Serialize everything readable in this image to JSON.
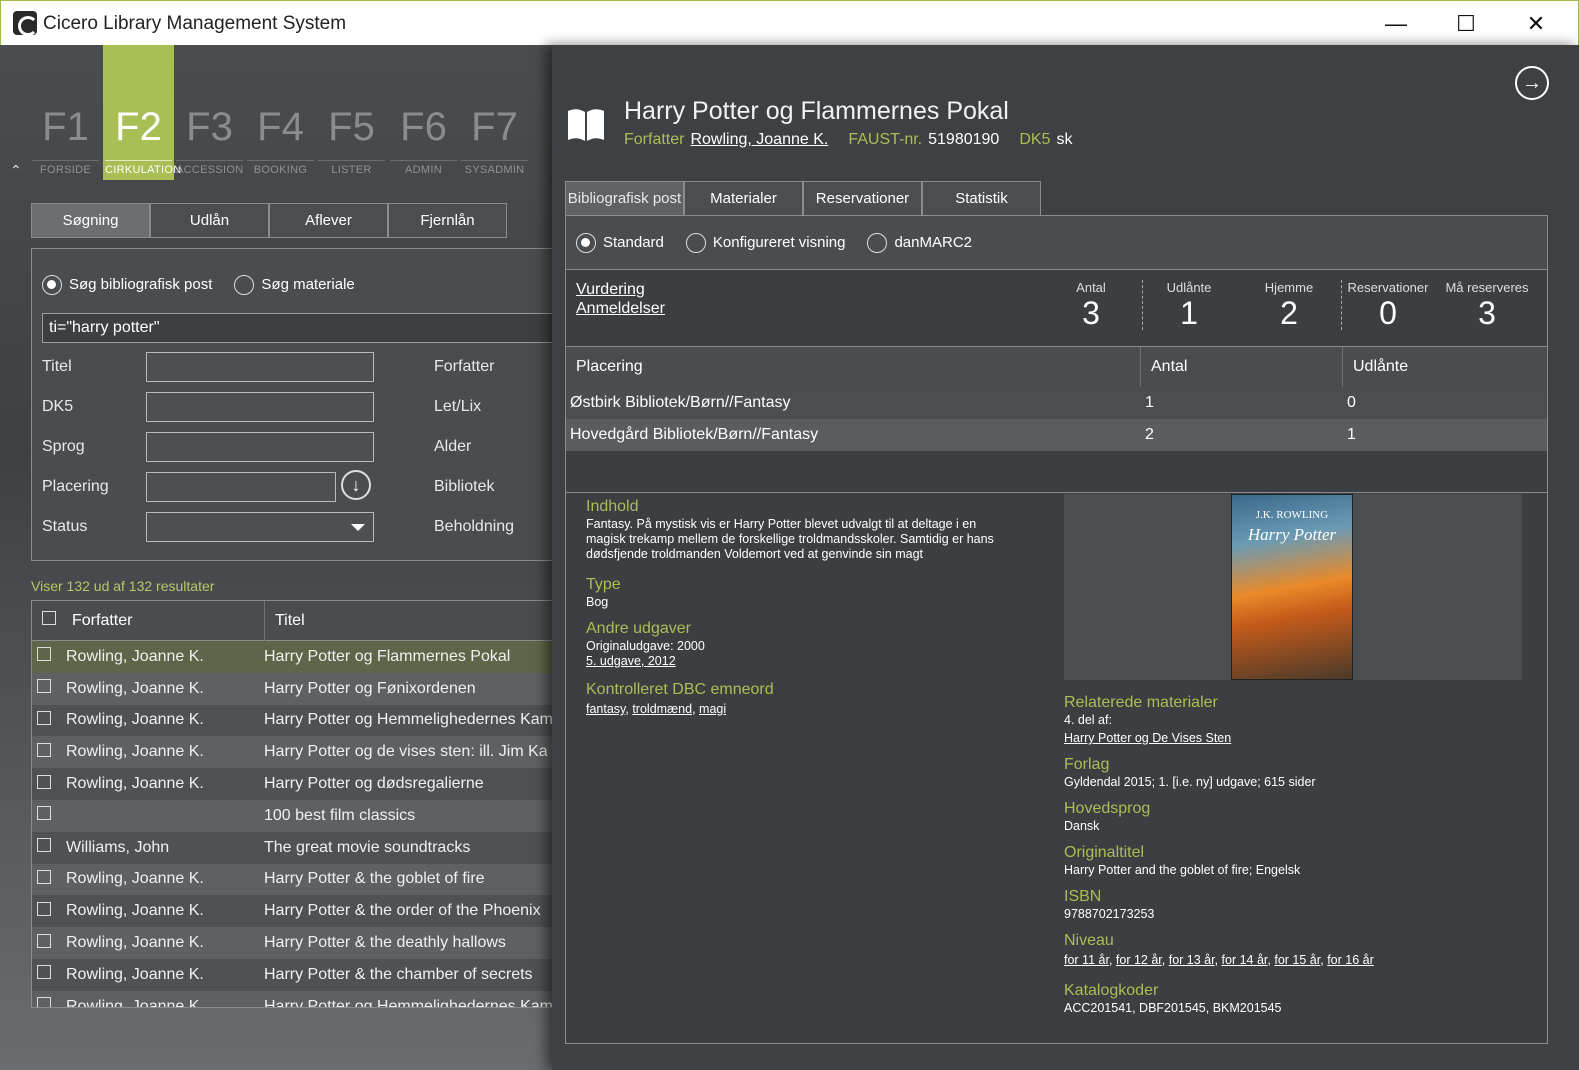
{
  "window": {
    "title": "Cicero Library Management System"
  },
  "fkeys": [
    {
      "key": "F1",
      "label": "FORSIDE"
    },
    {
      "key": "F2",
      "label": "CIRKULATION",
      "active": true
    },
    {
      "key": "F3",
      "label": "ACCESSION"
    },
    {
      "key": "F4",
      "label": "BOOKING"
    },
    {
      "key": "F5",
      "label": "LISTER"
    },
    {
      "key": "F6",
      "label": "ADMIN"
    },
    {
      "key": "F7",
      "label": "SYSADMIN"
    }
  ],
  "left_tabs": [
    "Søgning",
    "Udlån",
    "Aflever",
    "Fjernlån"
  ],
  "search": {
    "radio_bib": "Søg bibliografisk post",
    "radio_mat": "Søg materiale",
    "query": "ti=\"harry potter\"",
    "fields_left": [
      "Titel",
      "DK5",
      "Sprog",
      "Placering",
      "Status"
    ],
    "fields_right": [
      "Forfatter",
      "Let/Lix",
      "Alder",
      "Bibliotek",
      "Beholdning"
    ]
  },
  "results_text": "Viser 132 ud af 132 resultater",
  "grid": {
    "headers": [
      "Forfatter",
      "Titel"
    ],
    "rows": [
      [
        "Rowling, Joanne K.",
        "Harry Potter og Flammernes Pokal"
      ],
      [
        "Rowling, Joanne K.",
        "Harry Potter og Fønixordenen"
      ],
      [
        "Rowling, Joanne K.",
        "Harry Potter og Hemmelighedernes Kam"
      ],
      [
        "Rowling, Joanne K.",
        "Harry Potter og de vises sten: ill. Jim Ka"
      ],
      [
        "Rowling, Joanne K.",
        "Harry Potter og dødsregalierne"
      ],
      [
        "",
        "100 best film classics"
      ],
      [
        "Williams, John",
        "The great movie soundtracks"
      ],
      [
        "Rowling, Joanne K.",
        "Harry Potter & the goblet of fire"
      ],
      [
        "Rowling, Joanne K.",
        "Harry Potter & the order of the Phoenix"
      ],
      [
        "Rowling, Joanne K.",
        "Harry Potter & the deathly hallows"
      ],
      [
        "Rowling, Joanne K.",
        "Harry Potter & the chamber of secrets"
      ],
      [
        "Rowling, Joanne K.",
        "Harry Potter og Hemmelighedernes Kam"
      ]
    ]
  },
  "record": {
    "title": "Harry Potter og Flammernes Pokal",
    "author_label": "Forfatter",
    "author": "Rowling, Joanne K.",
    "faust_label": "FAUST-nr.",
    "faust": "51980190",
    "dk5_label": "DK5",
    "dk5": "sk"
  },
  "right_tabs": [
    "Bibliografisk post",
    "Materialer",
    "Reservationer",
    "Statistik"
  ],
  "view_modes": [
    "Standard",
    "Konfigureret visning",
    "danMARC2"
  ],
  "links": {
    "vurdering": "Vurdering",
    "anmeldelser": "Anmeldelser"
  },
  "stats": [
    {
      "label": "Antal",
      "value": "3"
    },
    {
      "label": "Udlånte",
      "value": "1"
    },
    {
      "label": "Hjemme",
      "value": "2"
    },
    {
      "label": "Reservationer",
      "value": "0"
    },
    {
      "label": "Må reserveres",
      "value": "3"
    }
  ],
  "placement": {
    "headers": [
      "Placering",
      "Antal",
      "Udlånte"
    ],
    "rows": [
      [
        "Østbirk Bibliotek/Børn//Fantasy",
        "1",
        "0"
      ],
      [
        "Hovedgård Bibliotek/Børn//Fantasy",
        "2",
        "1"
      ]
    ]
  },
  "details": {
    "indhold_h": "Indhold",
    "indhold": "Fantasy. På mystisk vis er Harry Potter blevet udvalgt til at deltage i en magisk trekamp mellem de forskellige troldmandsskoler. Samtidig er hans dødsfjende troldmanden Voldemort ved at genvinde sin magt",
    "type_h": "Type",
    "type": "Bog",
    "andre_h": "Andre udgaver",
    "andre_1": "Originaludgave: 2000",
    "andre_2": "5. udgave, 2012",
    "emneord_h": "Kontrolleret DBC emneord",
    "emneord": [
      "fantasy",
      "troldmænd",
      "magi"
    ],
    "rel_h": "Relaterede materialer",
    "rel_1": "4. del af:",
    "rel_2": "Harry Potter og De Vises Sten",
    "forlag_h": "Forlag",
    "forlag": "Gyldendal 2015; 1. [i.e. ny] udgave; 615 sider",
    "sprog_h": "Hovedsprog",
    "sprog": "Dansk",
    "orig_h": "Originaltitel",
    "orig": "Harry Potter and the goblet of fire; Engelsk",
    "isbn_h": "ISBN",
    "isbn": "9788702173253",
    "niveau_h": "Niveau",
    "niveau": [
      "for 11 år",
      "for 12 år",
      "for 13 år",
      "for 14 år",
      "for 15 år",
      "for 16 år"
    ],
    "kat_h": "Katalogkoder",
    "kat": "ACC201541, DBF201545, BKM201545"
  },
  "cover": {
    "author": "J.K. ROWLING",
    "title": "Harry Potter"
  }
}
